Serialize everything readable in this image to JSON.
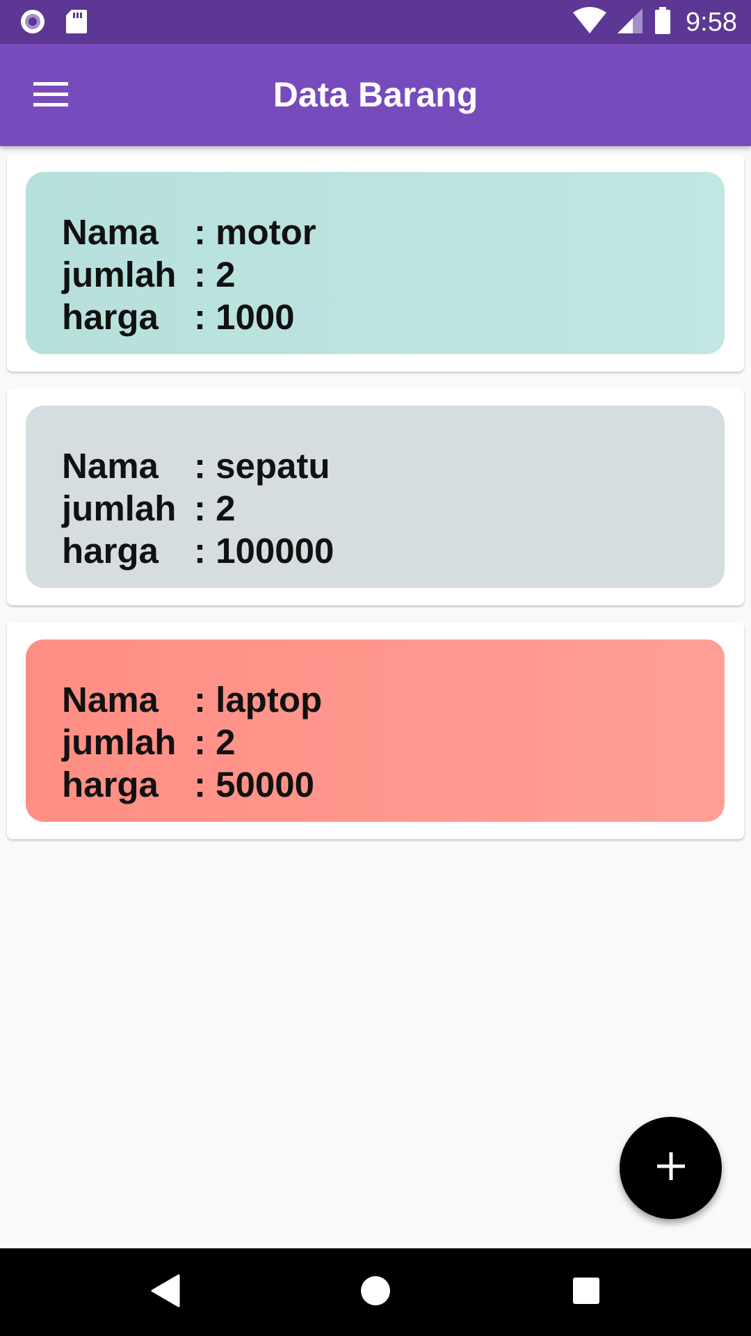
{
  "status_bar": {
    "time": "9:58",
    "icons": [
      "record-icon",
      "sd-card-icon",
      "wifi-icon",
      "signal-icon",
      "battery-icon"
    ]
  },
  "app_bar": {
    "title": "Data Barang",
    "menu_icon": "hamburger-menu-icon",
    "color": "#784bbd"
  },
  "items": [
    {
      "nama_label": "Nama",
      "nama_value": ": motor",
      "jumlah_label": "jumlah",
      "jumlah_value": ": 2",
      "harga_label": "harga",
      "harga_value": ": 1000",
      "color": "#b9e3e0"
    },
    {
      "nama_label": "Nama",
      "nama_value": ": sepatu",
      "jumlah_label": "jumlah",
      "jumlah_value": ": 2",
      "harga_label": "harga",
      "harga_value": ": 100000",
      "color": "#d6dde1"
    },
    {
      "nama_label": "Nama",
      "nama_value": ": laptop",
      "jumlah_label": "jumlah",
      "jumlah_value": ": 2",
      "harga_label": "harga",
      "harga_value": ": 50000",
      "color": "#ff968c"
    }
  ],
  "fab": {
    "icon": "plus-icon",
    "color": "#000000"
  },
  "nav_bar": {
    "icons": [
      "back-icon",
      "home-icon",
      "recents-icon"
    ]
  }
}
